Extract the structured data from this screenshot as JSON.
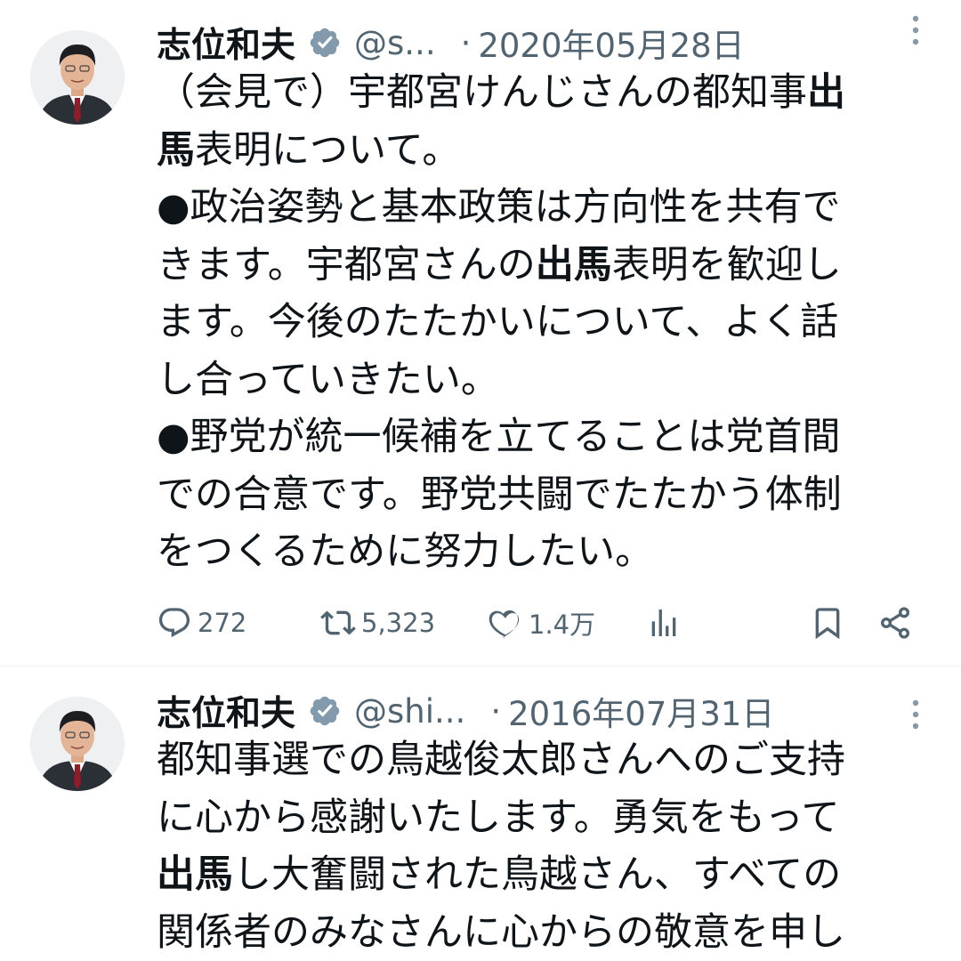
{
  "tweets": [
    {
      "author_name": "志位和夫",
      "handle": "@s...",
      "dot": "·",
      "date": "2020年05月28日",
      "lines": [
        [
          {
            "t": "（会見で）宇都宮けんじさんの都知事"
          },
          {
            "t": "出",
            "b": true
          }
        ],
        [
          {
            "t": "馬",
            "b": true
          },
          {
            "t": "表明について。"
          }
        ],
        [
          {
            "t": "●政治姿勢と基本政策は方向性を共有で"
          }
        ],
        [
          {
            "t": "きます。宇都宮さんの"
          },
          {
            "t": "出馬",
            "b": true
          },
          {
            "t": "表明を歓迎し"
          }
        ],
        [
          {
            "t": "ます。今後のたたかいについて、よく話"
          }
        ],
        [
          {
            "t": "し合っていきたい。"
          }
        ],
        [
          {
            "t": "●野党が統一候補を立てることは党首間"
          }
        ],
        [
          {
            "t": "での合意です。野党共闘でたたかう体制"
          }
        ],
        [
          {
            "t": "をつくるために努力したい。"
          }
        ]
      ],
      "replies": "272",
      "retweets": "5,323",
      "likes": "1.4万"
    },
    {
      "author_name": "志位和夫",
      "handle": "@shi...",
      "dot": "·",
      "date": "2016年07月31日",
      "lines": [
        [
          {
            "t": "都知事選での鳥越俊太郎さんへのご支持"
          }
        ],
        [
          {
            "t": "に心から感謝いたします。勇気をもって"
          }
        ],
        [
          {
            "t": "出馬",
            "b": true
          },
          {
            "t": "し大奮闘された鳥越さん、すべての"
          }
        ],
        [
          {
            "t": "関係者のみなさんに心からの敬意を申し"
          }
        ]
      ]
    }
  ],
  "icons": {
    "verified": "verified-badge-icon",
    "more": "more-vertical-icon",
    "reply": "reply-icon",
    "retweet": "retweet-icon",
    "like": "heart-icon",
    "views": "views-icon",
    "bookmark": "bookmark-icon",
    "share": "share-icon"
  },
  "colors": {
    "text": "#0f1419",
    "secondary": "#536471",
    "verified_badge": "#829aab",
    "divider": "#eff3f4"
  }
}
